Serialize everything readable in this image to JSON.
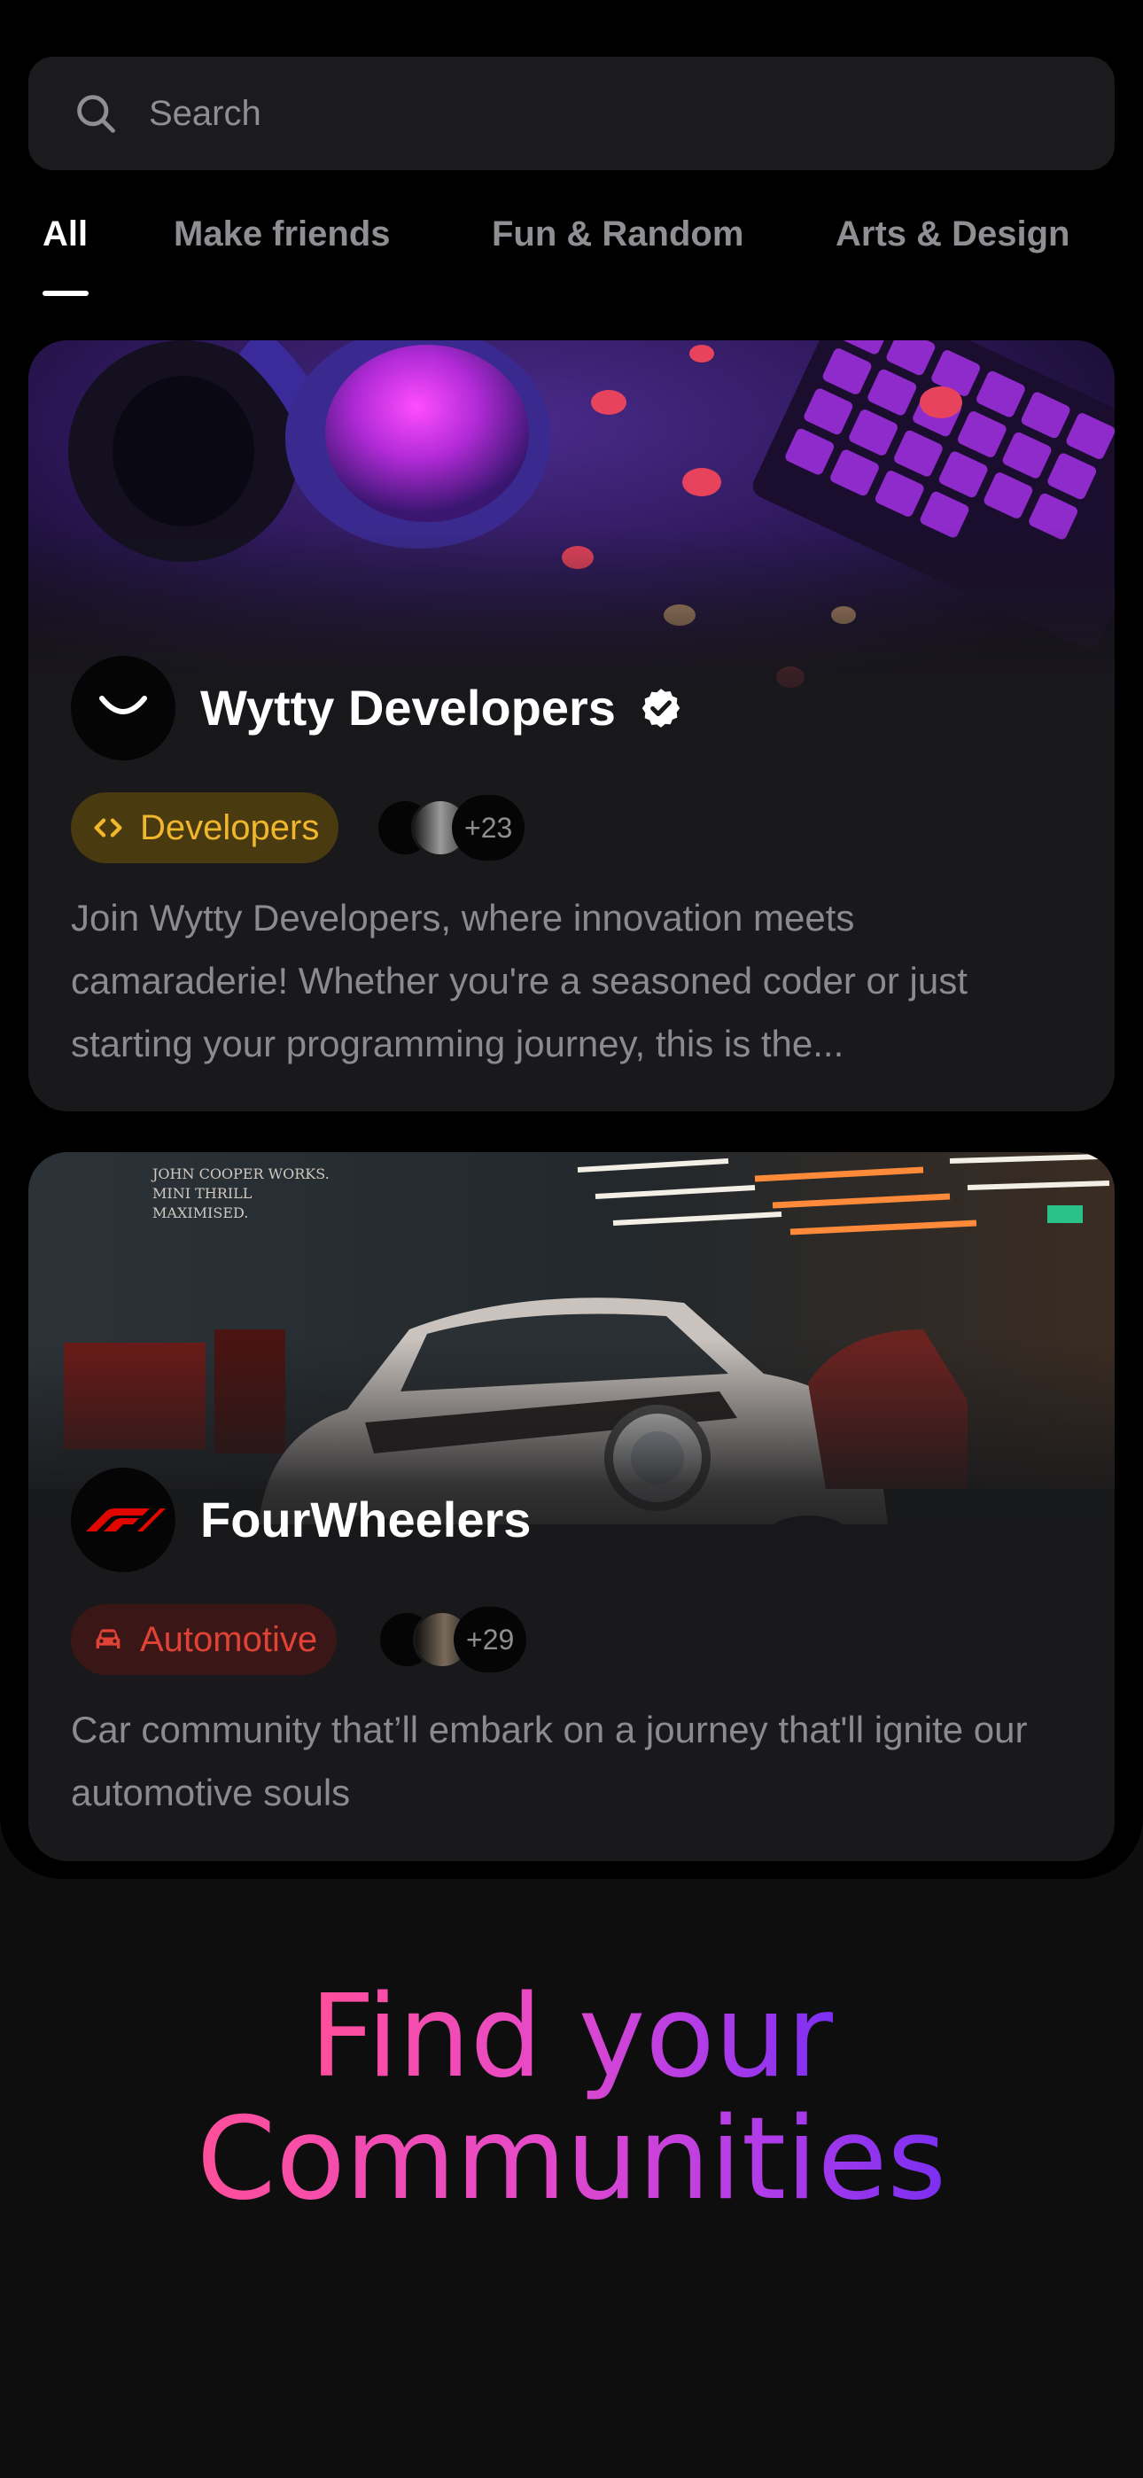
{
  "search": {
    "placeholder": "Search"
  },
  "tabs": [
    {
      "label": "All",
      "active": true
    },
    {
      "label": "Make friends",
      "active": false
    },
    {
      "label": "Fun & Random",
      "active": false
    },
    {
      "label": "Arts & Design",
      "active": false
    }
  ],
  "communities": [
    {
      "name": "Wytty Developers",
      "verified": true,
      "avatar_icon": "smile-icon",
      "banner_icon": "gaming-headset-keyboard-image",
      "category": {
        "label": "Developers",
        "icon": "code-icon",
        "color": "#f0b72c",
        "bg": "#4a3a10"
      },
      "member_count": "+23",
      "description": "Join Wytty Developers, where innovation meets camaraderie! Whether you're a seasoned coder or just starting your programming journey, this is the..."
    },
    {
      "name": "FourWheelers",
      "verified": false,
      "avatar_icon": "f1-logo-icon",
      "banner_icon": "mini-cooper-garage-image",
      "category": {
        "label": "Automotive",
        "icon": "car-icon",
        "color": "#e04236",
        "bg": "#3a1616"
      },
      "member_count": "+29",
      "description": "Car community that’ll embark on a journey that'll ignite our automotive souls"
    }
  ],
  "hero": {
    "line1": "Find your",
    "line2": "Communities"
  }
}
